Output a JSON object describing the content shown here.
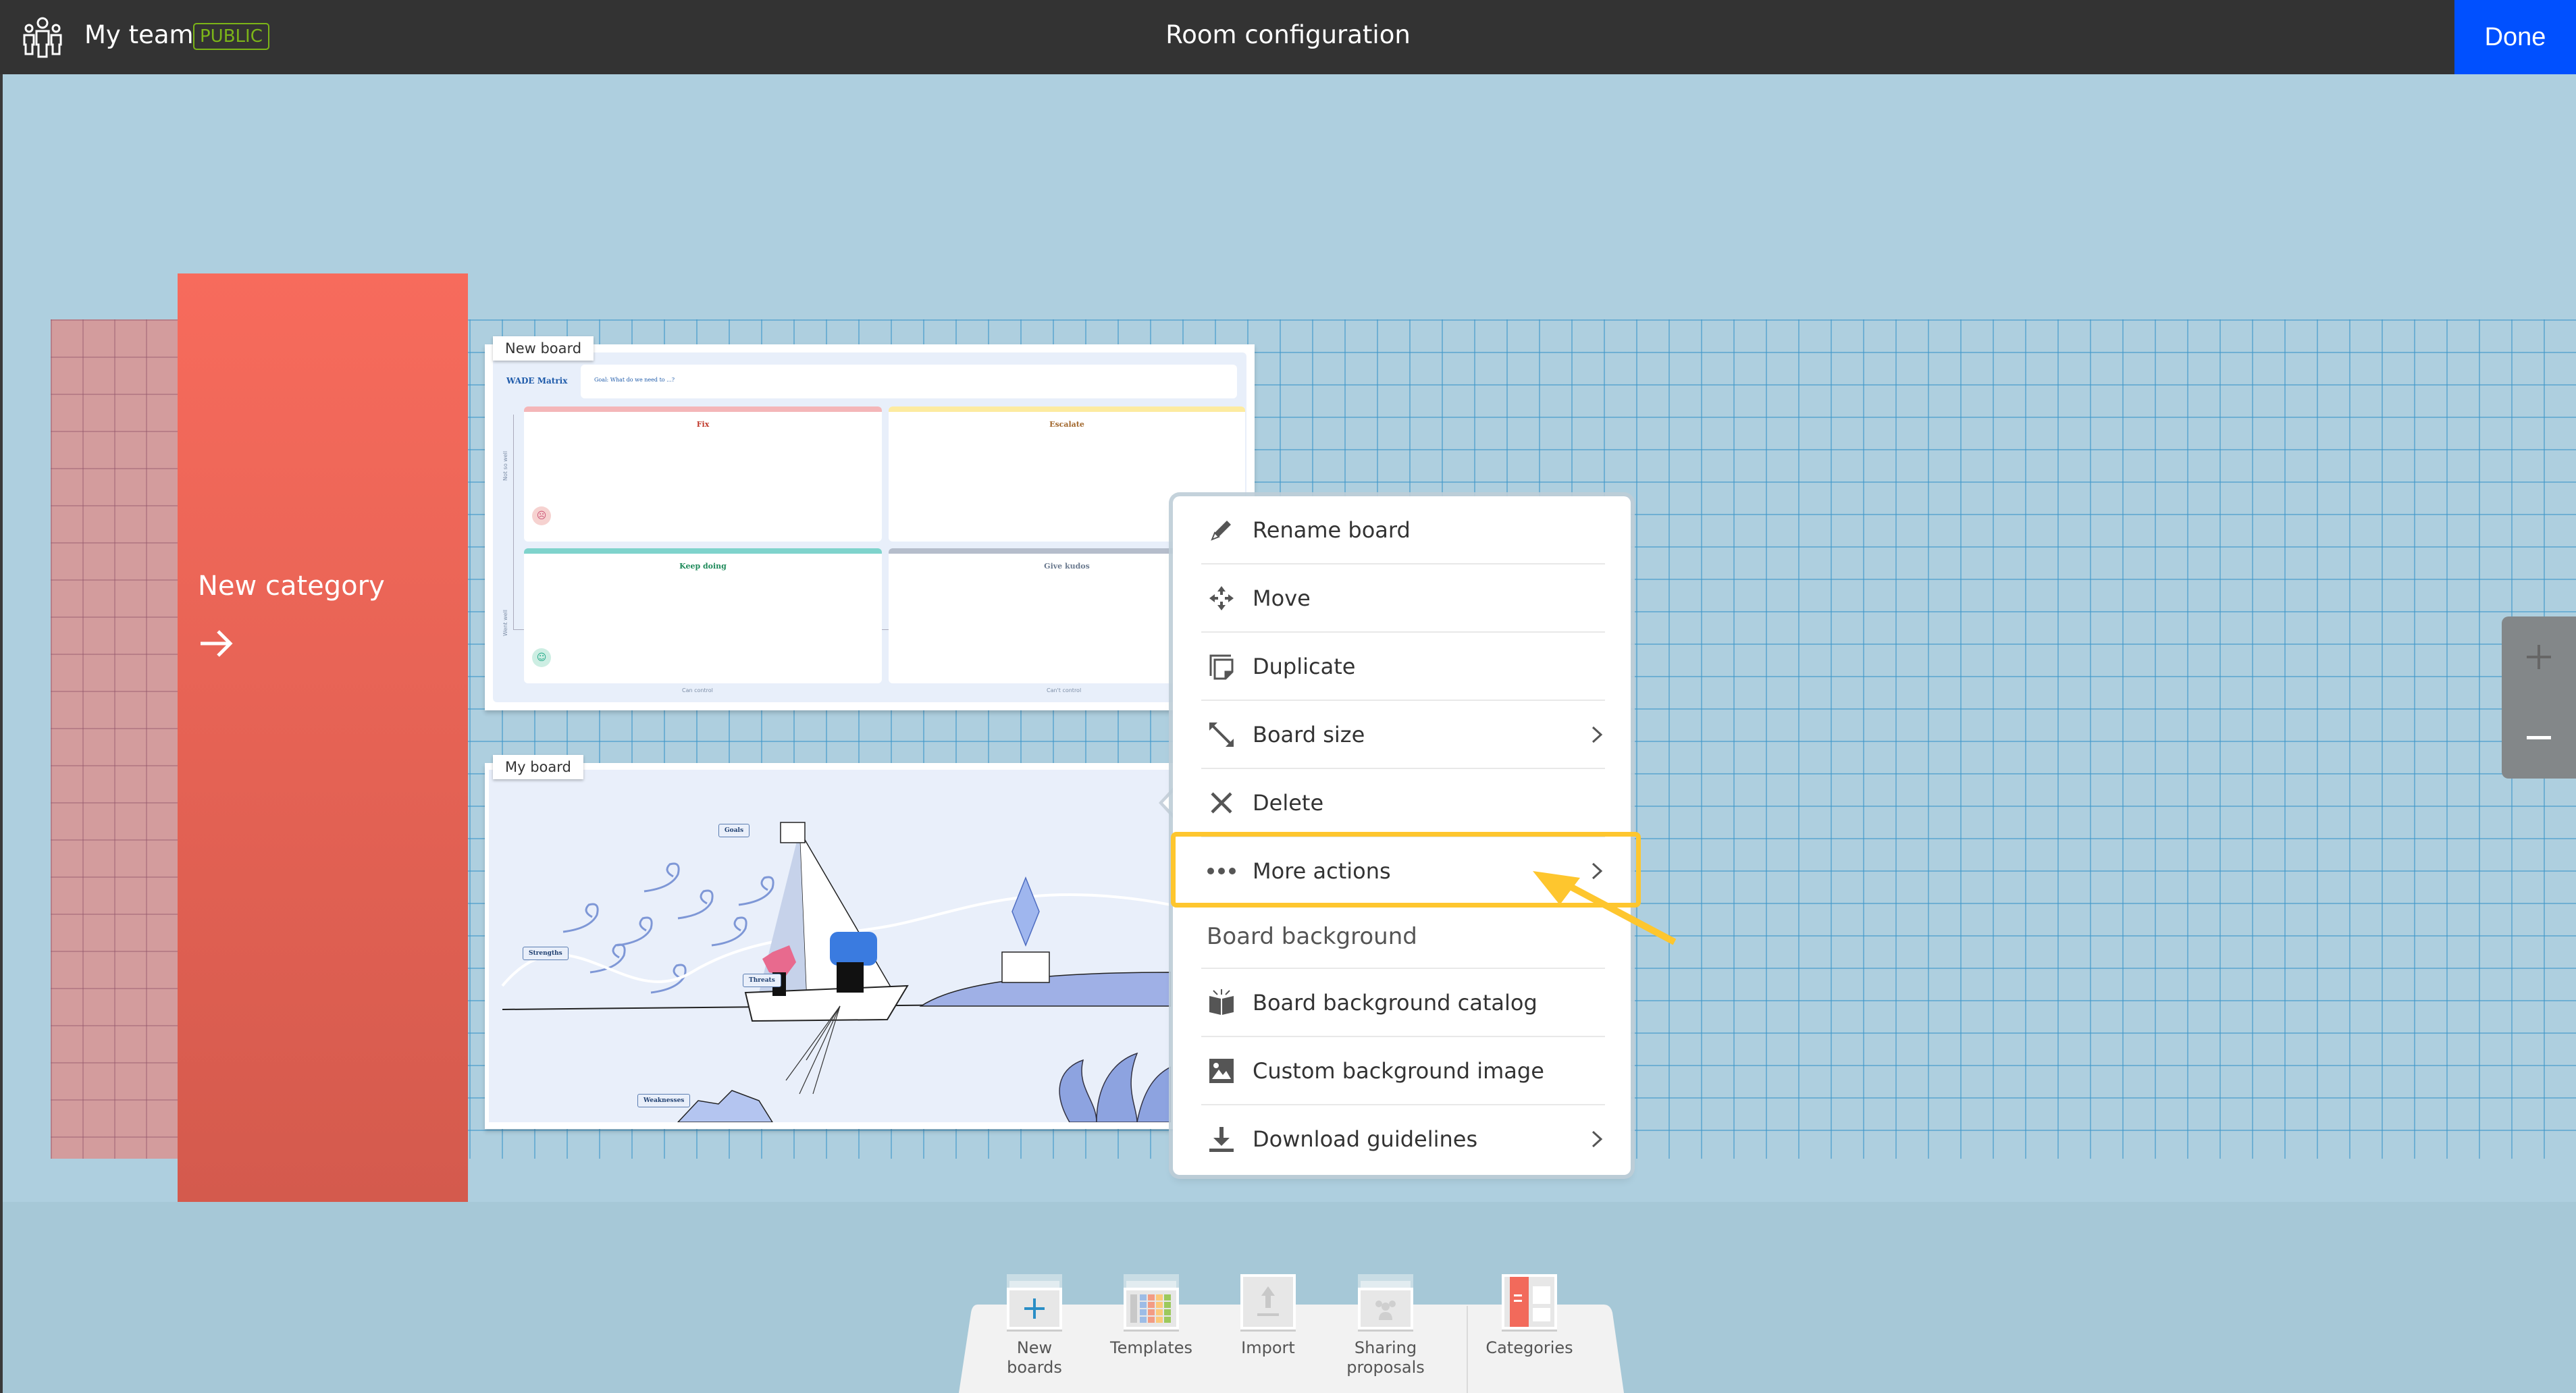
{
  "header": {
    "team_name": "My team",
    "visibility_badge": "PUBLIC",
    "title": "Room configuration",
    "done_label": "Done"
  },
  "colors": {
    "header_bg": "#333333",
    "done_bg": "#0050FF",
    "badge": "#7CB518",
    "category": "#F26A5B",
    "highlight": "#FEC62E",
    "canvas": "#AECFDF"
  },
  "category": {
    "label": "New category",
    "arrow_icon": "arrow-right-icon"
  },
  "boards": [
    {
      "tag": "New board",
      "template_title": "WADE Matrix",
      "goal_text": "Goal: What do we need to ...?",
      "quadrants": [
        {
          "label": "Fix",
          "color": "#F4B6B8",
          "text_color": "#C0392B"
        },
        {
          "label": "Escalate",
          "color": "#FDEBA0",
          "text_color": "#A0652A"
        },
        {
          "label": "Keep doing",
          "color": "#7FD3CC",
          "text_color": "#1E8A5A"
        },
        {
          "label": "Give kudos",
          "color": "#B5BDCB",
          "text_color": "#6B7A8F"
        }
      ],
      "y_axis_labels": [
        "Not so well",
        "Went well"
      ],
      "x_axis_labels": [
        "Can control",
        "Can't control"
      ]
    },
    {
      "tag": "My board",
      "labels": [
        "Strengths",
        "Goals",
        "Threats",
        "Weaknesses"
      ]
    }
  ],
  "context_menu": {
    "items": [
      {
        "label": "Rename board",
        "icon": "pencil-icon",
        "has_submenu": false
      },
      {
        "label": "Move",
        "icon": "move-icon",
        "has_submenu": false
      },
      {
        "label": "Duplicate",
        "icon": "duplicate-icon",
        "has_submenu": false
      },
      {
        "label": "Board size",
        "icon": "resize-icon",
        "has_submenu": true
      },
      {
        "label": "Delete",
        "icon": "close-icon",
        "has_submenu": false
      },
      {
        "label": "More actions",
        "icon": "more-dots-icon",
        "has_submenu": true,
        "highlighted": true
      }
    ],
    "section_title": "Board background",
    "section_items": [
      {
        "label": "Board background catalog",
        "icon": "book-icon",
        "has_submenu": false
      },
      {
        "label": "Custom background image",
        "icon": "image-icon",
        "has_submenu": false
      },
      {
        "label": "Download guidelines",
        "icon": "download-icon",
        "has_submenu": true
      }
    ]
  },
  "zoom_controls": {
    "zoom_in_icon": "plus-icon",
    "zoom_out_icon": "minus-icon"
  },
  "toolbar": {
    "items": [
      {
        "label": "New boards",
        "icon": "plus-icon"
      },
      {
        "label": "Templates",
        "icon": "templates-icon"
      },
      {
        "label": "Import",
        "icon": "upload-icon"
      },
      {
        "label": "Sharing proposals",
        "icon": "group-icon"
      },
      {
        "label": "Categories",
        "icon": "categories-icon"
      }
    ]
  }
}
